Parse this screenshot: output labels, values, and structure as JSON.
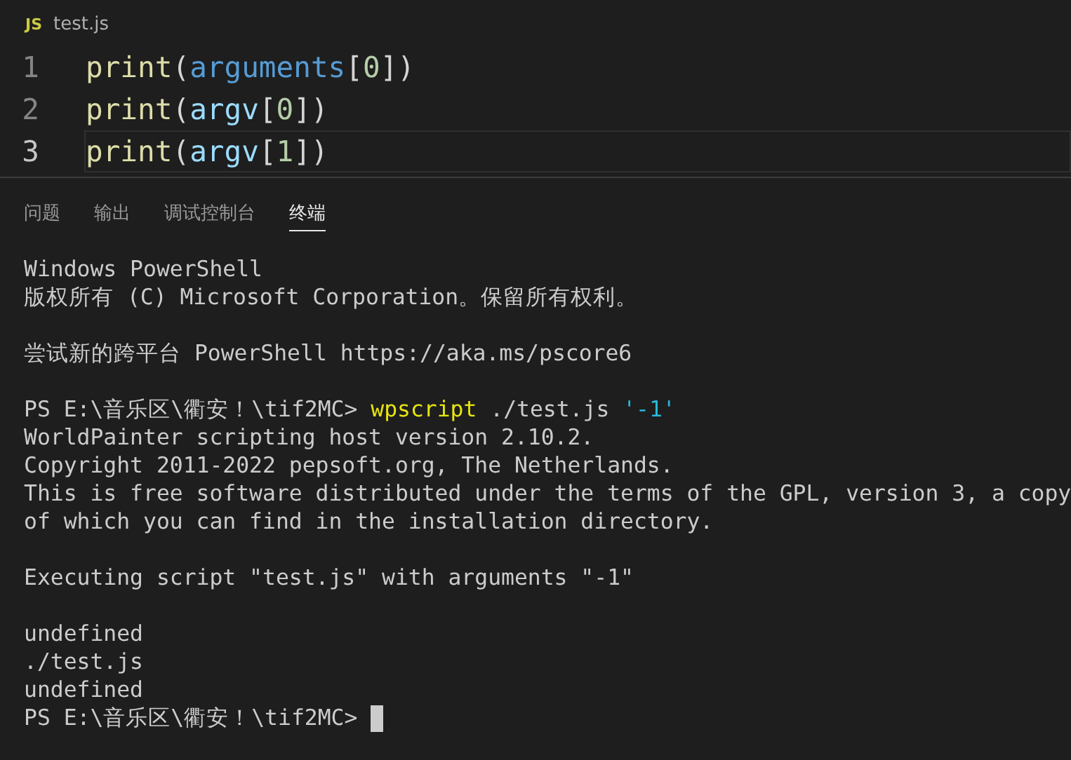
{
  "editor": {
    "file_tab": {
      "icon_text": "JS",
      "name": "test.js"
    },
    "lines": [
      {
        "number": "1",
        "current": false,
        "tokens": [
          {
            "text": "print",
            "kind": "function"
          },
          {
            "text": "(",
            "kind": "punct"
          },
          {
            "text": "arguments",
            "kind": "keyword"
          },
          {
            "text": "[",
            "kind": "punct"
          },
          {
            "text": "0",
            "kind": "number"
          },
          {
            "text": "])",
            "kind": "punct"
          }
        ]
      },
      {
        "number": "2",
        "current": false,
        "tokens": [
          {
            "text": "print",
            "kind": "function"
          },
          {
            "text": "(",
            "kind": "punct"
          },
          {
            "text": "argv",
            "kind": "variable"
          },
          {
            "text": "[",
            "kind": "punct"
          },
          {
            "text": "0",
            "kind": "number"
          },
          {
            "text": "])",
            "kind": "punct"
          }
        ]
      },
      {
        "number": "3",
        "current": true,
        "tokens": [
          {
            "text": "print",
            "kind": "function"
          },
          {
            "text": "(",
            "kind": "punct"
          },
          {
            "text": "argv",
            "kind": "variable"
          },
          {
            "text": "[",
            "kind": "punct"
          },
          {
            "text": "1",
            "kind": "number"
          },
          {
            "text": "])",
            "kind": "punct"
          }
        ]
      }
    ]
  },
  "panel": {
    "tabs": [
      {
        "label": "问题",
        "selected": false
      },
      {
        "label": "输出",
        "selected": false
      },
      {
        "label": "调试控制台",
        "selected": false
      },
      {
        "label": "终端",
        "selected": true
      }
    ],
    "terminal": [
      {
        "kind": "text",
        "segments": [
          {
            "text": "Windows PowerShell",
            "kind": "plain"
          }
        ]
      },
      {
        "kind": "text",
        "segments": [
          {
            "text": "版权所有 (C) Microsoft Corporation。保留所有权利。",
            "kind": "plain"
          }
        ]
      },
      {
        "kind": "blank"
      },
      {
        "kind": "text",
        "segments": [
          {
            "text": "尝试新的跨平台 PowerShell https://aka.ms/pscore6",
            "kind": "plain"
          }
        ]
      },
      {
        "kind": "blank"
      },
      {
        "kind": "text",
        "segments": [
          {
            "text": "PS E:\\音乐区\\衢安！\\tif2MC> ",
            "kind": "plain"
          },
          {
            "text": "wpscript",
            "kind": "command"
          },
          {
            "text": " ./test.js ",
            "kind": "plain"
          },
          {
            "text": "'-1'",
            "kind": "string"
          }
        ]
      },
      {
        "kind": "text",
        "segments": [
          {
            "text": "WorldPainter scripting host version 2.10.2.",
            "kind": "plain"
          }
        ]
      },
      {
        "kind": "text",
        "segments": [
          {
            "text": "Copyright 2011-2022 pepsoft.org, The Netherlands.",
            "kind": "plain"
          }
        ]
      },
      {
        "kind": "text",
        "segments": [
          {
            "text": "This is free software distributed under the terms of the GPL, version 3, a copy",
            "kind": "plain"
          }
        ]
      },
      {
        "kind": "text",
        "segments": [
          {
            "text": "of which you can find in the installation directory.",
            "kind": "plain"
          }
        ]
      },
      {
        "kind": "blank"
      },
      {
        "kind": "text",
        "segments": [
          {
            "text": "Executing script \"test.js\" with arguments \"-1\"",
            "kind": "plain"
          }
        ]
      },
      {
        "kind": "blank"
      },
      {
        "kind": "text",
        "segments": [
          {
            "text": "undefined",
            "kind": "plain"
          }
        ]
      },
      {
        "kind": "text",
        "segments": [
          {
            "text": "./test.js",
            "kind": "plain"
          }
        ]
      },
      {
        "kind": "text",
        "segments": [
          {
            "text": "undefined",
            "kind": "plain"
          }
        ]
      },
      {
        "kind": "prompt",
        "segments": [
          {
            "text": "PS E:\\音乐区\\衢安！\\tif2MC> ",
            "kind": "plain"
          }
        ]
      }
    ]
  }
}
